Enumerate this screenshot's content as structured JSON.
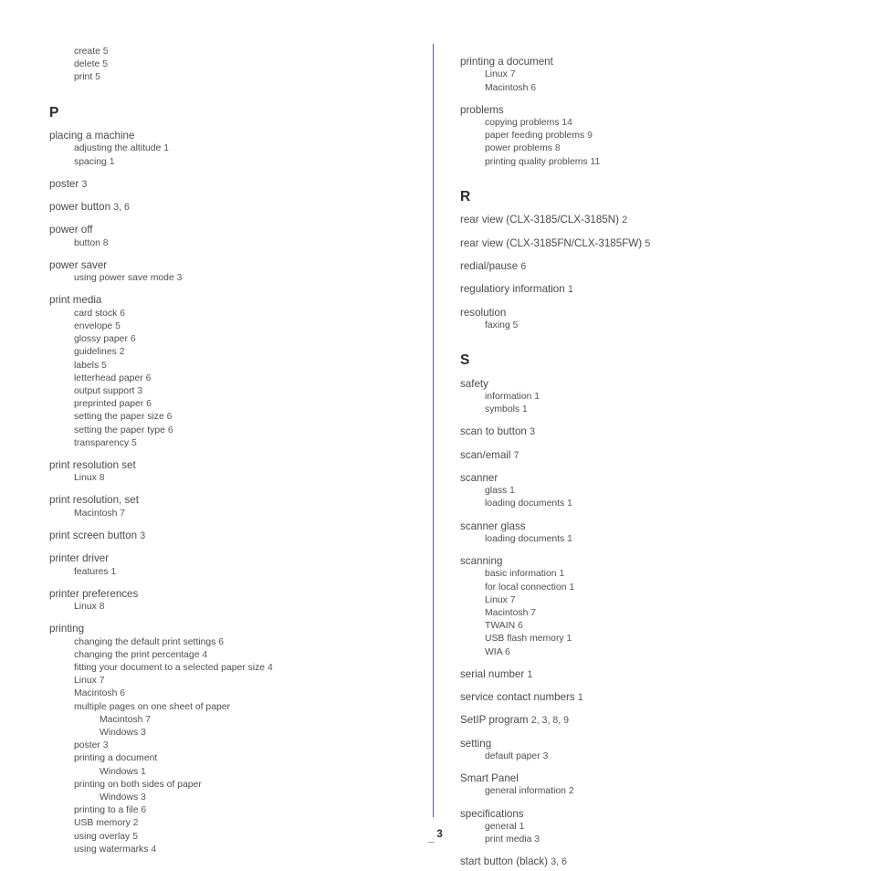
{
  "page": {
    "footer_dash": "_",
    "footer_number": "3"
  },
  "columns": {
    "left": [
      {
        "type": "sub",
        "text": "create",
        "page": "5"
      },
      {
        "type": "sub",
        "text": "delete",
        "page": "5"
      },
      {
        "type": "sub",
        "text": "print",
        "page": "5"
      },
      {
        "type": "letter",
        "text": "P"
      },
      {
        "type": "entry",
        "text": "placing a machine",
        "page": ""
      },
      {
        "type": "sub",
        "text": "adjusting the altitude",
        "page": "1"
      },
      {
        "type": "sub",
        "text": "spacing",
        "page": "1"
      },
      {
        "type": "entry",
        "text": "poster",
        "page": "3"
      },
      {
        "type": "entry",
        "text": "power button",
        "page": "3, 6"
      },
      {
        "type": "entry",
        "text": "power off",
        "page": ""
      },
      {
        "type": "sub",
        "text": "button",
        "page": "8"
      },
      {
        "type": "entry",
        "text": "power saver",
        "page": ""
      },
      {
        "type": "sub",
        "text": "using power save mode",
        "page": "3"
      },
      {
        "type": "entry",
        "text": "print media",
        "page": ""
      },
      {
        "type": "sub",
        "text": "card stock",
        "page": "6"
      },
      {
        "type": "sub",
        "text": "envelope",
        "page": "5"
      },
      {
        "type": "sub",
        "text": "glossy paper",
        "page": "6"
      },
      {
        "type": "sub",
        "text": "guidelines",
        "page": "2"
      },
      {
        "type": "sub",
        "text": "labels",
        "page": "5"
      },
      {
        "type": "sub",
        "text": "letterhead paper",
        "page": "6"
      },
      {
        "type": "sub",
        "text": "output support",
        "page": "3"
      },
      {
        "type": "sub",
        "text": "preprinted paper",
        "page": "6"
      },
      {
        "type": "sub",
        "text": "setting the paper size",
        "page": "6"
      },
      {
        "type": "sub",
        "text": "setting the paper type",
        "page": "6"
      },
      {
        "type": "sub",
        "text": "transparency",
        "page": "5"
      },
      {
        "type": "entry",
        "text": "print resolution set",
        "page": ""
      },
      {
        "type": "sub",
        "text": "Linux",
        "page": "8"
      },
      {
        "type": "entry",
        "text": "print resolution, set",
        "page": ""
      },
      {
        "type": "sub",
        "text": "Macintosh",
        "page": "7"
      },
      {
        "type": "entry",
        "text": "print screen button",
        "page": "3"
      },
      {
        "type": "entry",
        "text": "printer driver",
        "page": ""
      },
      {
        "type": "sub",
        "text": "features",
        "page": "1"
      },
      {
        "type": "entry",
        "text": "printer preferences",
        "page": ""
      },
      {
        "type": "sub",
        "text": "Linux",
        "page": "8"
      },
      {
        "type": "entry",
        "text": "printing",
        "page": ""
      },
      {
        "type": "sub",
        "text": "changing the default print settings",
        "page": "6"
      },
      {
        "type": "sub",
        "text": "changing the print percentage",
        "page": "4"
      },
      {
        "type": "sub",
        "text": "fitting your document to a selected paper size",
        "page": "4"
      },
      {
        "type": "sub",
        "text": "Linux",
        "page": "7"
      },
      {
        "type": "sub",
        "text": "Macintosh",
        "page": "6"
      },
      {
        "type": "sub",
        "text": "multiple pages on one sheet of paper",
        "page": ""
      },
      {
        "type": "subsub",
        "text": "Macintosh",
        "page": "7"
      },
      {
        "type": "subsub",
        "text": "Windows",
        "page": "3"
      },
      {
        "type": "sub",
        "text": "poster",
        "page": "3"
      },
      {
        "type": "sub",
        "text": "printing a document",
        "page": ""
      },
      {
        "type": "subsub",
        "text": "Windows",
        "page": "1"
      },
      {
        "type": "sub",
        "text": "printing on both sides of paper",
        "page": ""
      },
      {
        "type": "subsub",
        "text": "Windows",
        "page": "3"
      },
      {
        "type": "sub",
        "text": "printing to a file",
        "page": "6"
      },
      {
        "type": "sub",
        "text": "USB memory",
        "page": "2"
      },
      {
        "type": "sub",
        "text": "using overlay",
        "page": "5"
      },
      {
        "type": "sub",
        "text": "using watermarks",
        "page": "4"
      }
    ],
    "right": [
      {
        "type": "entry",
        "text": "printing a document",
        "page": ""
      },
      {
        "type": "sub",
        "text": "Linux",
        "page": "7"
      },
      {
        "type": "sub",
        "text": "Macintosh",
        "page": "6"
      },
      {
        "type": "entry",
        "text": "problems",
        "page": ""
      },
      {
        "type": "sub",
        "text": "copying problems",
        "page": "14"
      },
      {
        "type": "sub",
        "text": "paper feeding problems",
        "page": "9"
      },
      {
        "type": "sub",
        "text": "power problems",
        "page": "8"
      },
      {
        "type": "sub",
        "text": "printing quality problems",
        "page": "11"
      },
      {
        "type": "letter",
        "text": "R"
      },
      {
        "type": "entry",
        "text": "rear view (CLX-3185/CLX-3185N)",
        "page": "2"
      },
      {
        "type": "entry",
        "text": "rear view (CLX-3185FN/CLX-3185FW)",
        "page": "5"
      },
      {
        "type": "entry",
        "text": "redial/pause",
        "page": "6"
      },
      {
        "type": "entry",
        "text": "regulatiory information",
        "page": "1"
      },
      {
        "type": "entry",
        "text": "resolution",
        "page": ""
      },
      {
        "type": "sub",
        "text": "faxing",
        "page": "5"
      },
      {
        "type": "letter",
        "text": "S"
      },
      {
        "type": "entry",
        "text": "safety",
        "page": ""
      },
      {
        "type": "sub",
        "text": "information",
        "page": "1"
      },
      {
        "type": "sub",
        "text": "symbols",
        "page": "1"
      },
      {
        "type": "entry",
        "text": "scan to button",
        "page": "3"
      },
      {
        "type": "entry",
        "text": "scan/email",
        "page": "7"
      },
      {
        "type": "entry",
        "text": "scanner",
        "page": ""
      },
      {
        "type": "sub",
        "text": "glass",
        "page": "1"
      },
      {
        "type": "sub",
        "text": "loading documents",
        "page": "1"
      },
      {
        "type": "entry",
        "text": "scanner glass",
        "page": ""
      },
      {
        "type": "sub",
        "text": "loading documents",
        "page": "1"
      },
      {
        "type": "entry",
        "text": "scanning",
        "page": ""
      },
      {
        "type": "sub",
        "text": "basic information",
        "page": "1"
      },
      {
        "type": "sub",
        "text": "for local connection",
        "page": "1"
      },
      {
        "type": "sub",
        "text": "Linux",
        "page": "7"
      },
      {
        "type": "sub",
        "text": "Macintosh",
        "page": "7"
      },
      {
        "type": "sub",
        "text": "TWAIN",
        "page": "6"
      },
      {
        "type": "sub",
        "text": "USB flash memory",
        "page": "1"
      },
      {
        "type": "sub",
        "text": "WIA",
        "page": "6"
      },
      {
        "type": "entry",
        "text": "serial number",
        "page": "1"
      },
      {
        "type": "entry",
        "text": "service contact numbers",
        "page": "1"
      },
      {
        "type": "entry",
        "text": "SetIP program",
        "page": "2, 3, 8, 9"
      },
      {
        "type": "entry",
        "text": "setting",
        "page": ""
      },
      {
        "type": "sub",
        "text": "default paper",
        "page": "3"
      },
      {
        "type": "entry",
        "text": "Smart Panel",
        "page": ""
      },
      {
        "type": "sub",
        "text": "general information",
        "page": "2"
      },
      {
        "type": "entry",
        "text": "specifications",
        "page": ""
      },
      {
        "type": "sub",
        "text": "general",
        "page": "1"
      },
      {
        "type": "sub",
        "text": "print media",
        "page": "3"
      },
      {
        "type": "entry",
        "text": "start button (black)",
        "page": "3, 6"
      }
    ]
  }
}
